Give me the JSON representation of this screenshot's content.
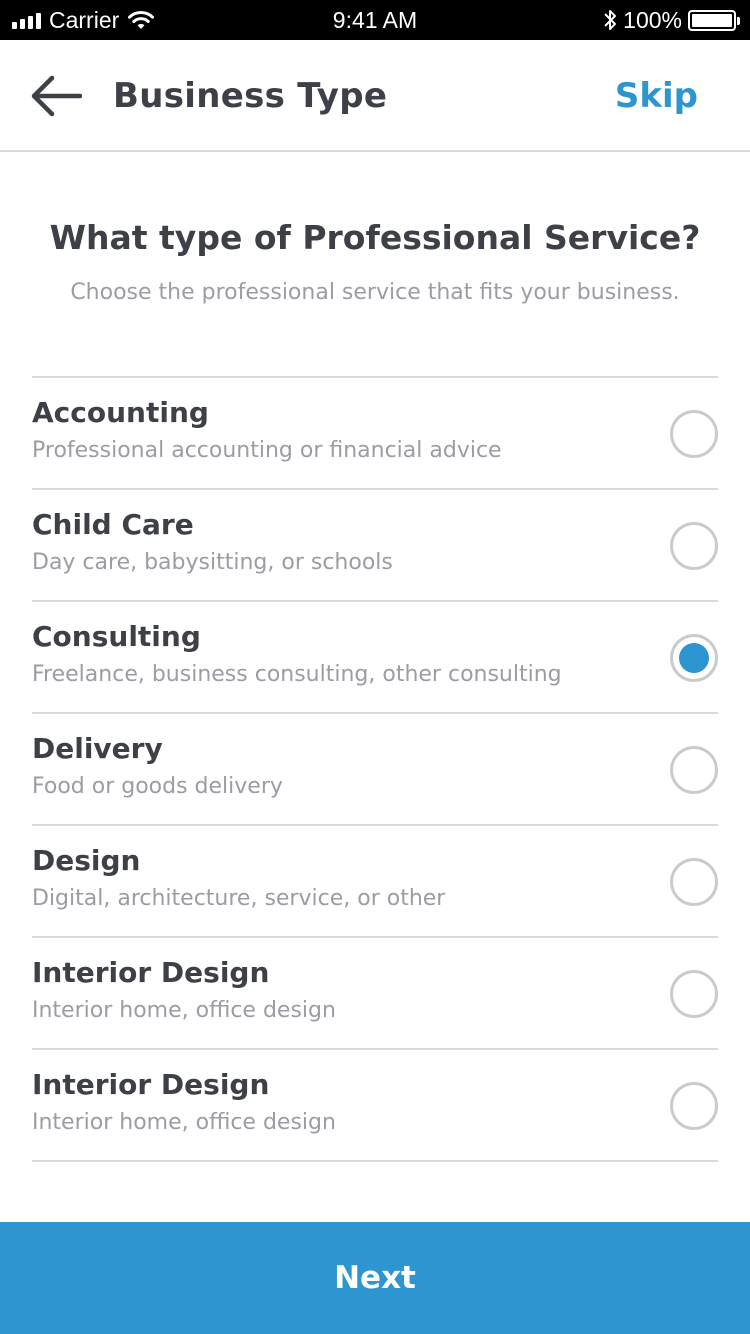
{
  "status_bar": {
    "carrier": "Carrier",
    "time": "9:41 AM",
    "battery": "100%",
    "icons": [
      "signal-icon",
      "wifi-icon",
      "bluetooth-icon",
      "battery-icon"
    ]
  },
  "nav": {
    "back_icon": "arrow-left-icon",
    "title": "Business Type",
    "skip_label": "Skip"
  },
  "main": {
    "heading": "What type of Professional Service?",
    "subheading": "Choose the professional service that fits your business."
  },
  "options": [
    {
      "title": "Accounting",
      "description": "Professional accounting or financial advice",
      "selected": false
    },
    {
      "title": "Child Care",
      "description": "Day care, babysitting, or schools",
      "selected": false
    },
    {
      "title": "Consulting",
      "description": "Freelance, business consulting, other consulting",
      "selected": true
    },
    {
      "title": "Delivery",
      "description": "Food or goods delivery",
      "selected": false
    },
    {
      "title": "Design",
      "description": "Digital, architecture, service, or other",
      "selected": false
    },
    {
      "title": "Interior Design",
      "description": "Interior home, office design",
      "selected": false
    },
    {
      "title": "Interior Design",
      "description": "Interior home, office design",
      "selected": false
    }
  ],
  "footer": {
    "next_label": "Next"
  },
  "colors": {
    "accent": "#2d95cf",
    "title_text": "#3d4047",
    "secondary_text": "#9a9da3",
    "divider": "#d9dadc",
    "radio_border": "#c9cbcd"
  }
}
